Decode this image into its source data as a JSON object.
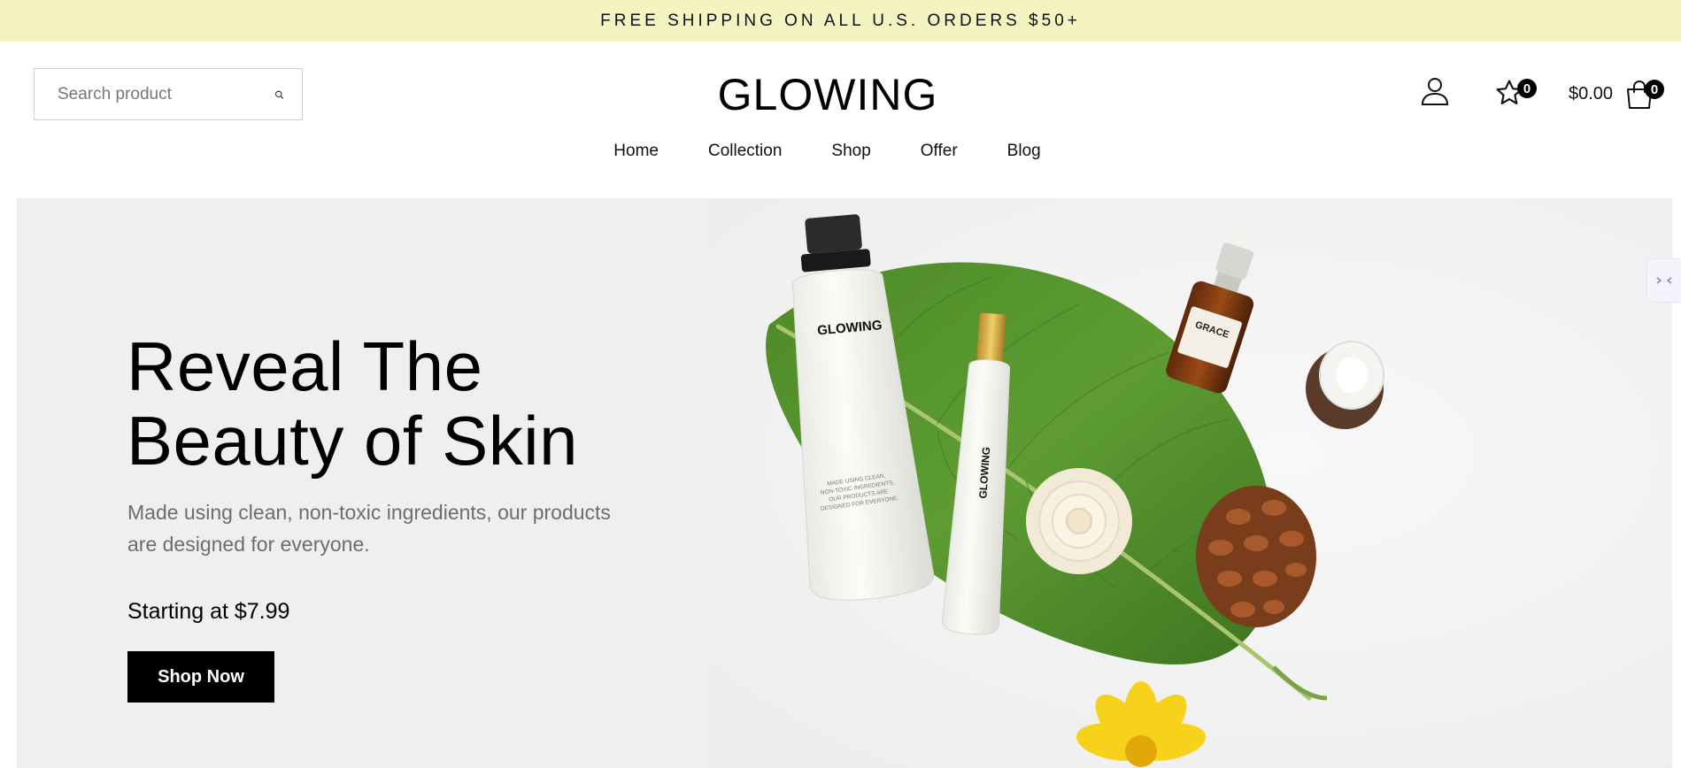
{
  "announcement": {
    "text": "FREE SHIPPING ON ALL U.S. ORDERS $50+"
  },
  "header": {
    "search_placeholder": "Search product",
    "logo": "GLOWING",
    "wishlist_count": "0",
    "cart_total": "$0.00",
    "cart_count": "0"
  },
  "nav": {
    "items": [
      {
        "label": "Home"
      },
      {
        "label": "Collection"
      },
      {
        "label": "Shop"
      },
      {
        "label": "Offer"
      },
      {
        "label": "Blog"
      }
    ]
  },
  "hero": {
    "title_line1": "Reveal The",
    "title_line2": "Beauty of Skin",
    "description": "Made using clean, non-toxic ingredients, our products are designed for everyone.",
    "price_text": "Starting at $7.99",
    "button_label": "Shop Now",
    "image_labels": {
      "tube_brand": "GLOWING",
      "tube_text": "MADE USING CLEAN, NON-TOXIC INGREDIENTS, OUR PRODUCTS ARE DESIGNED FOR EVERYONE.",
      "small_tube_brand": "GLOWING",
      "bottle_brand": "GRACE"
    }
  },
  "colors": {
    "announcement_bg": "#f4f3c2",
    "hero_bg": "#efefef",
    "button_bg": "#000000",
    "leaf_green": "#4e8f2a"
  },
  "icons": {
    "search": "search-icon",
    "user": "user-icon",
    "wishlist": "star-icon",
    "cart": "shopping-bag-icon"
  }
}
